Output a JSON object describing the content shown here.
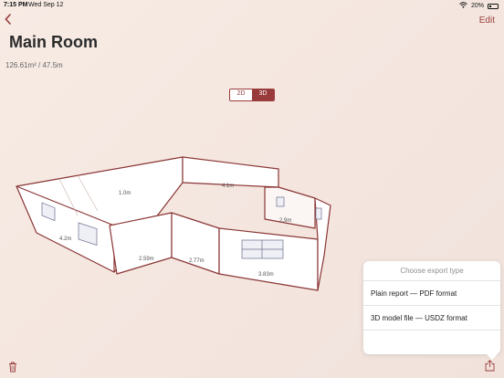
{
  "status": {
    "time": "7:15 PM",
    "date": "Wed Sep 12",
    "battery": "20%"
  },
  "nav": {
    "back_icon": "chevron-left-icon",
    "edit_label": "Edit"
  },
  "room": {
    "title": "Main Room",
    "stats": "126.61m² / 47.5m"
  },
  "view_toggle": {
    "options": [
      "2D",
      "3D"
    ],
    "selected": "3D"
  },
  "walls": {
    "labels": [
      "4.2m",
      "2.59m",
      "2.77m",
      "3.83m",
      "2.9m",
      "4.1m",
      "1.0m"
    ]
  },
  "export_menu": {
    "title": "Choose export type",
    "options": [
      "Plain report — PDF format",
      "3D model file — USDZ format"
    ]
  },
  "toolbar": {
    "delete_icon": "trash-icon",
    "share_icon": "share-icon"
  },
  "colors": {
    "accent": "#9a3b3b",
    "background": "#f5e8e1"
  }
}
